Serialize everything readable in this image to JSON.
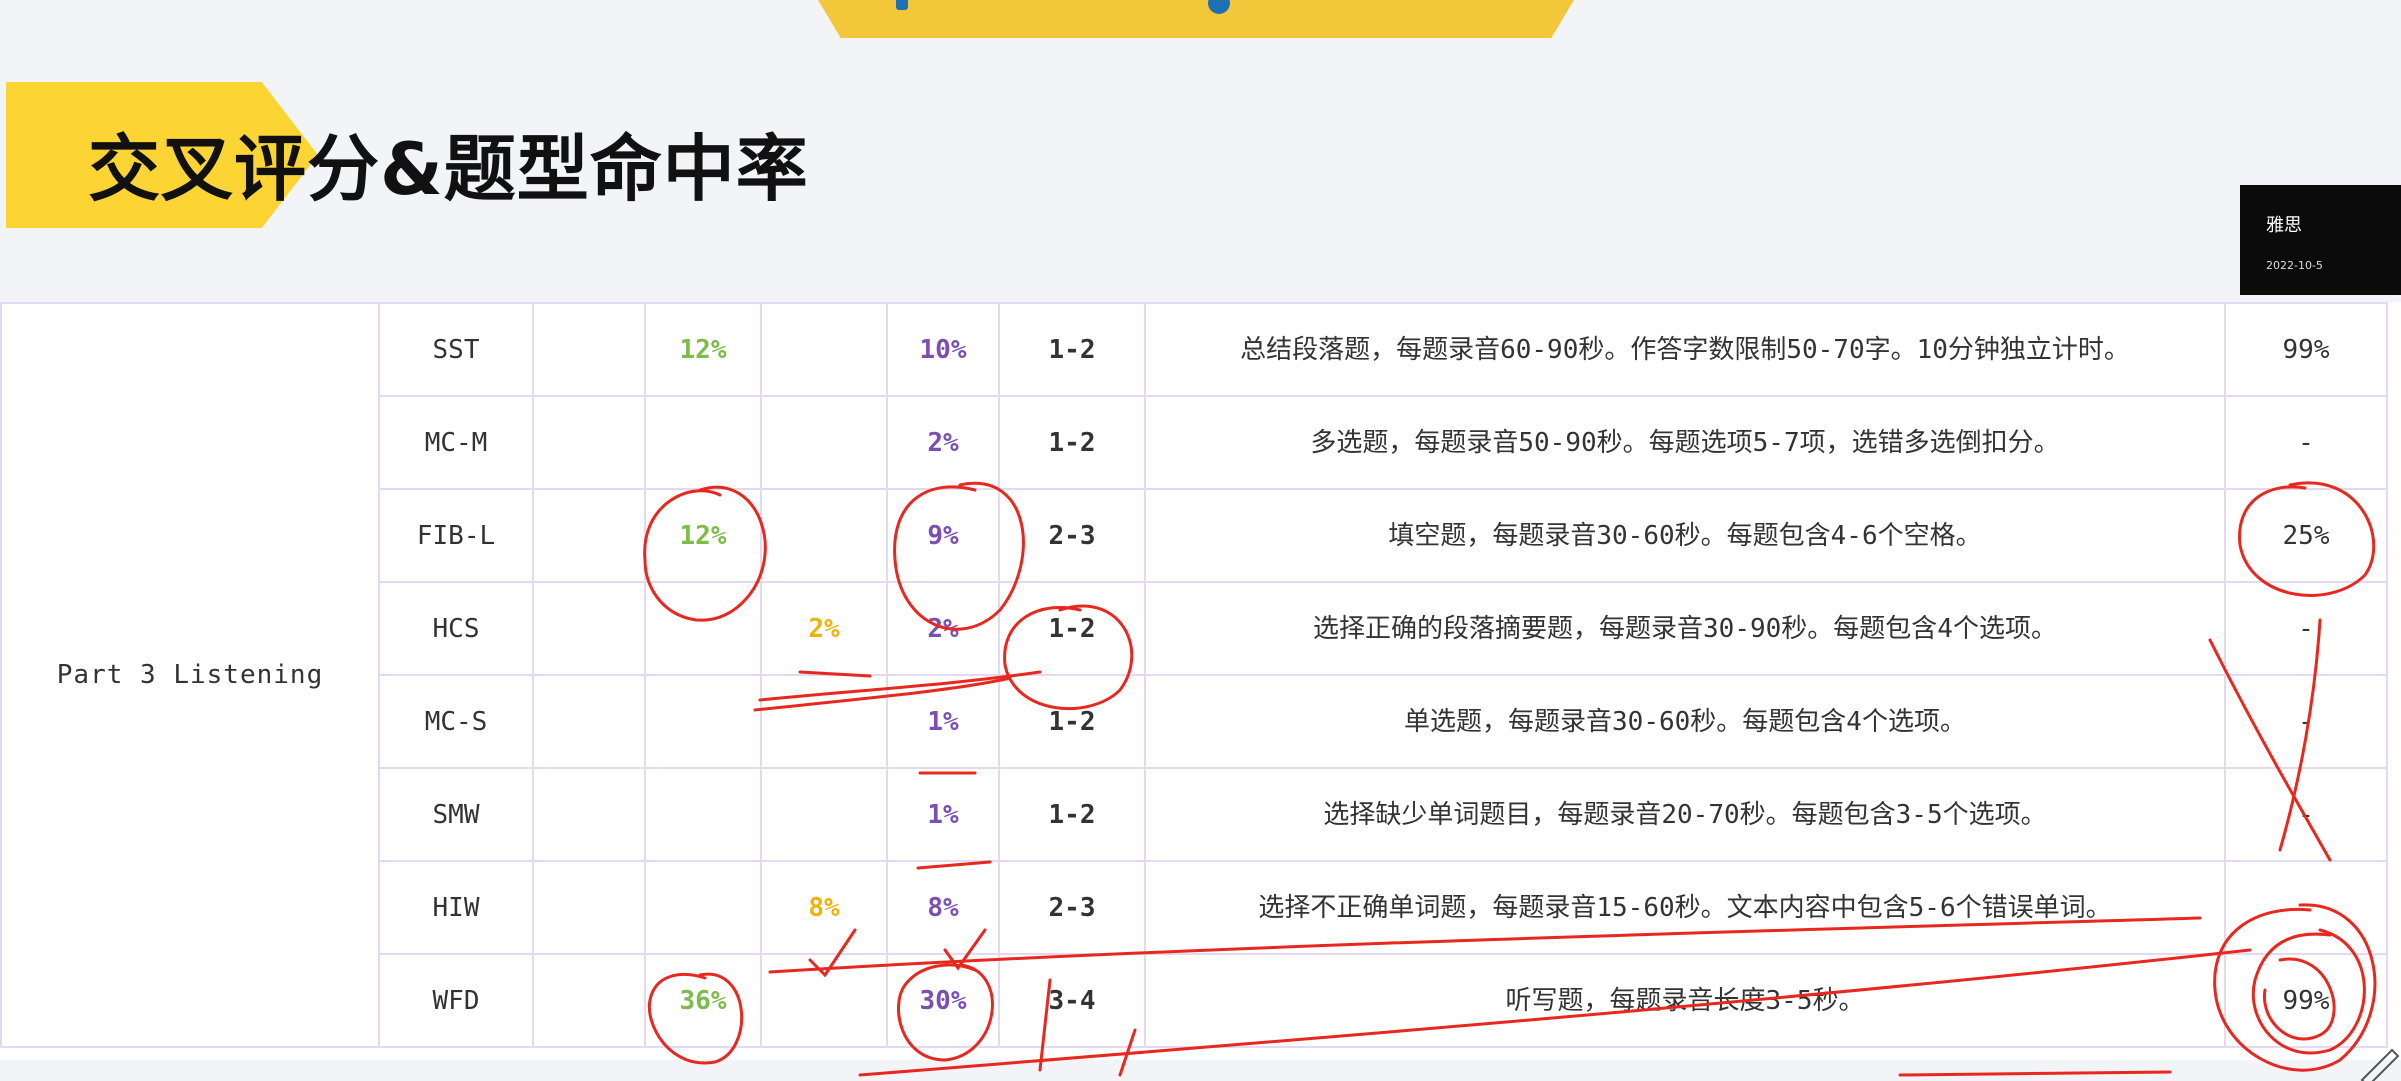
{
  "header": {
    "title": "交叉评分&题型命中率"
  },
  "side_badge": {
    "line1": "雅思",
    "line2": "2022-10-5"
  },
  "section_label": "Part 3 Listening",
  "rows": [
    {
      "code": "SST",
      "c1": "",
      "c2": "12%",
      "c3": "",
      "c4": "10%",
      "range": "1-2",
      "desc": "总结段落题，每题录音60-90秒。作答字数限制50-70字。10分钟独立计时。",
      "hit": "99%"
    },
    {
      "code": "MC-M",
      "c1": "",
      "c2": "",
      "c3": "",
      "c4": "2%",
      "range": "1-2",
      "desc": "多选题，每题录音50-90秒。每题选项5-7项，选错多选倒扣分。",
      "hit": "-"
    },
    {
      "code": "FIB-L",
      "c1": "",
      "c2": "12%",
      "c3": "",
      "c4": "9%",
      "range": "2-3",
      "desc": "填空题，每题录音30-60秒。每题包含4-6个空格。",
      "hit": "25%"
    },
    {
      "code": "HCS",
      "c1": "",
      "c2": "",
      "c3": "2%",
      "c4": "2%",
      "range": "1-2",
      "desc": "选择正确的段落摘要题，每题录音30-90秒。每题包含4个选项。",
      "hit": "-"
    },
    {
      "code": "MC-S",
      "c1": "",
      "c2": "",
      "c3": "",
      "c4": "1%",
      "range": "1-2",
      "desc": "单选题，每题录音30-60秒。每题包含4个选项。",
      "hit": "-"
    },
    {
      "code": "SMW",
      "c1": "",
      "c2": "",
      "c3": "",
      "c4": "1%",
      "range": "1-2",
      "desc": "选择缺少单词题目，每题录音20-70秒。每题包含3-5个选项。",
      "hit": "-"
    },
    {
      "code": "HIW",
      "c1": "",
      "c2": "",
      "c3": "8%",
      "c4": "8%",
      "range": "2-3",
      "desc": "选择不正确单词题，每题录音15-60秒。文本内容中包含5-6个错误单词。",
      "hit": ""
    },
    {
      "code": "WFD",
      "c1": "",
      "c2": "36%",
      "c3": "",
      "c4": "30%",
      "range": "3-4",
      "desc": "听写题，每题录音长度3-5秒。",
      "hit": "99%"
    }
  ],
  "colors": {
    "accent_yellow": "#fcd535",
    "green": "#7dbb4a",
    "orange": "#f0b20a",
    "purple": "#7a4fb3",
    "annotation_red": "#e8281e"
  },
  "icons": {
    "pen": "pen-tool-icon"
  }
}
